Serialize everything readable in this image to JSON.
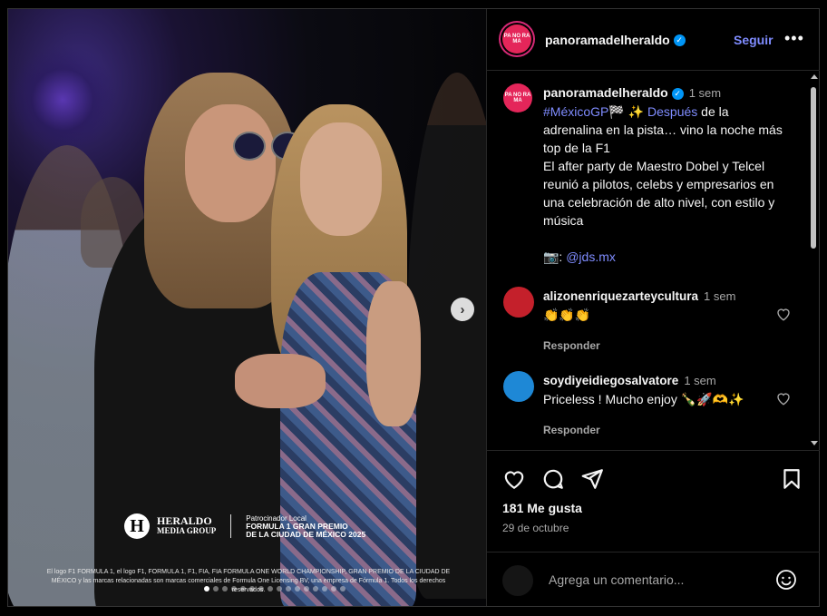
{
  "post": {
    "username": "panoramadelheraldo",
    "avatar_text": "PA NO RA MA",
    "follow_label": "Seguir",
    "more_label": "•••"
  },
  "image": {
    "brand_name_line1": "HERALDO",
    "brand_name_line2": "MEDIA GROUP",
    "sponsor_label": "Patrocinador Local",
    "sponsor_line1": "FORMULA 1 GRAN PREMIO",
    "sponsor_line2": "DE LA CIUDAD DE MÉXICO 2025",
    "disclaimer": "El logo F1 FORMULA 1, el logo F1, FORMULA 1, F1, FIA, FIA FORMULA ONE WORLD CHAMPIONSHIP, GRAN PREMIO DE LA CIUDAD DE MÉXICO y las marcas relacionadas son marcas comerciales de Formula One Licensing BV, una empresa de Fórmula 1. Todos los derechos reservados.",
    "carousel_next": "›"
  },
  "caption": {
    "username": "panoramadelheraldo",
    "time": "1 sem",
    "hashtag": "#MéxicoGP🏁",
    "sparkle": "✨",
    "highlight": "Después",
    "text1": " de la adrenalina en la pista… vino la noche más top de la F1",
    "text2": "El after party de Maestro Dobel y Telcel reunió a pilotos, celebs y empresarios en una celebración de alto nivel, con estilo y música",
    "credit_icon": "📷:",
    "credit_handle": "@jds.mx"
  },
  "comments": [
    {
      "username": "alizonenriquezarteycultura",
      "time": "1 sem",
      "text": "👏👏👏",
      "reply": "Responder",
      "avatar_color": "#c4202b"
    },
    {
      "username": "soydiyeidiegosalvatore",
      "time": "1 sem",
      "text": "Priceless ! Mucho enjoy 🍾🚀🫶✨",
      "reply": "Responder",
      "avatar_color": "#1e88d6"
    }
  ],
  "actions": {
    "likes": "181 Me gusta",
    "date": "29 de octubre",
    "comment_placeholder": "Agrega un comentario..."
  }
}
